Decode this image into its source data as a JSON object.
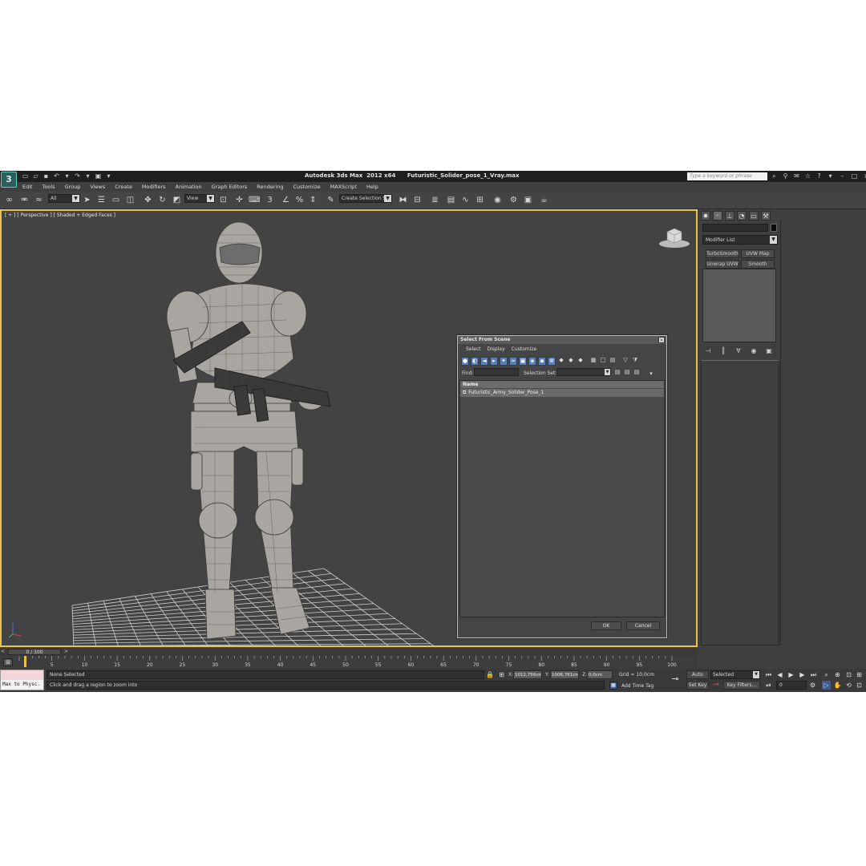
{
  "window": {
    "title": "Autodesk 3ds Max  2012 x64      Futuristic_Solider_pose_1_Vray.max",
    "search_placeholder": "Type a keyword or phrase",
    "logo_text": "3"
  },
  "menu": [
    "Edit",
    "Tools",
    "Group",
    "Views",
    "Create",
    "Modifiers",
    "Animation",
    "Graph Editors",
    "Rendering",
    "Customize",
    "MAXScript",
    "Help"
  ],
  "toolbar": {
    "selection_filter": "All",
    "ref_coord": "View",
    "named_selection": "Create Selection Se"
  },
  "viewport": {
    "label": "[ + ] [ Perspective ] [ Shaded + Edged Faces ]"
  },
  "command_panel": {
    "modifier_list_label": "Modifier List",
    "modifier_buttons": [
      "TurboSmooth",
      "UVW Map",
      "Unwrap UVW",
      "Smooth"
    ]
  },
  "dialog": {
    "title": "Select From Scene",
    "menu": [
      "Select",
      "Display",
      "Customize"
    ],
    "find_label": "Find:",
    "selection_set_label": "Selection Set:",
    "column_header": "Name",
    "rows": [
      "Futuristic_Army_Solider_Pose_1"
    ],
    "ok_label": "OK",
    "cancel_label": "Cancel"
  },
  "timeline": {
    "slider_label": "0 / 100",
    "nav_left": "<",
    "nav_right": ">",
    "ticks": [
      "0",
      "5",
      "10",
      "15",
      "20",
      "25",
      "30",
      "35",
      "40",
      "45",
      "50",
      "55",
      "60",
      "65",
      "70",
      "75",
      "80",
      "85",
      "90",
      "95",
      "100"
    ]
  },
  "status": {
    "maxscript_listener": "Max to Physc.",
    "selection_status": "None Selected",
    "prompt": "Click and drag a region to zoom into",
    "x_label": "X:",
    "x_value": "1012,756cm",
    "y_label": "Y:",
    "y_value": "1006,761cm",
    "z_label": "Z:",
    "z_value": "0,0cm",
    "grid": "Grid = 10,0cm",
    "add_time_tag": "Add Time Tag",
    "auto_key": "Auto Key",
    "set_key": "Set Key",
    "key_mode": "Selected",
    "key_filters": "Key Filters...",
    "current_frame": "0"
  }
}
